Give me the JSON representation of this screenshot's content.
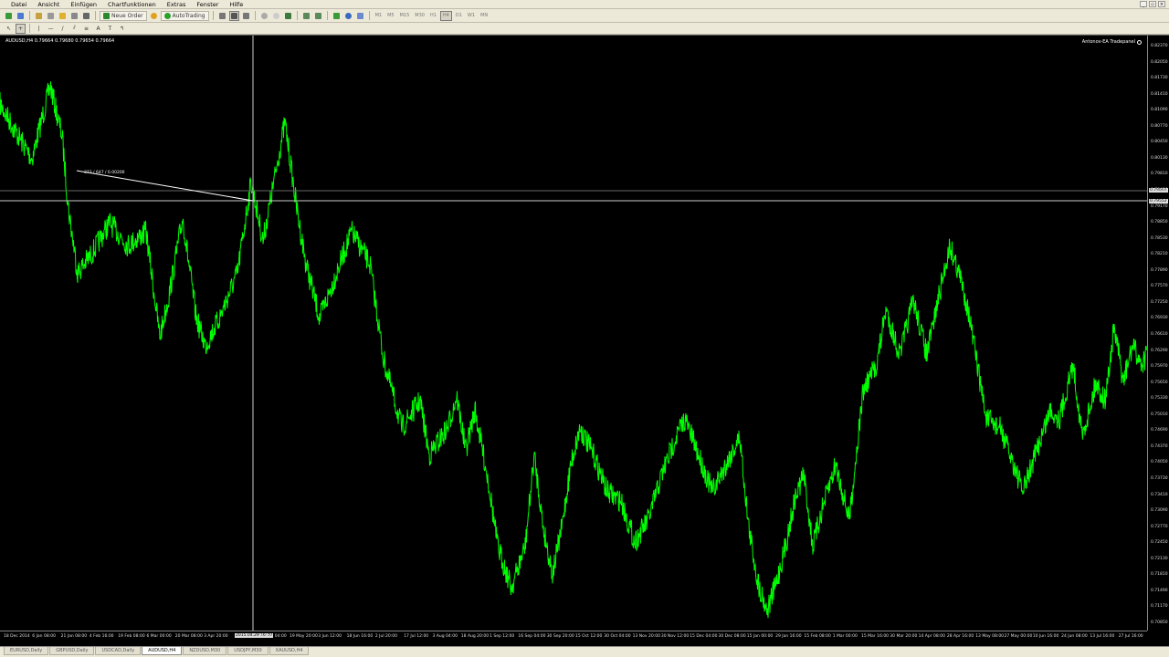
{
  "menu": {
    "items": [
      "Datei",
      "Ansicht",
      "Einfügen",
      "Chartfunktionen",
      "Extras",
      "Fenster",
      "Hilfe"
    ]
  },
  "toolbar": {
    "new_order_label": "Neue Order",
    "autotrading_label": "AutoTrading",
    "timeframes": [
      "M1",
      "M5",
      "M15",
      "M30",
      "H1",
      "H4",
      "D1",
      "W1",
      "MN"
    ]
  },
  "chart": {
    "symbol_header": "AUDUSD,H4  0.79664 0.79680 0.79654 0.79664",
    "ea_label": "Antonov-EA Tradepanel",
    "measure_label": "373 / 647 / 0.00200",
    "crosshair_time": "2015.04.29 16:00",
    "current_price_tag": "0.79664",
    "crosshair_price_tag": "0.79552",
    "line_color": "#00ff00",
    "price_labels": [
      "0.82370",
      "0.82050",
      "0.81730",
      "0.81410",
      "0.81090",
      "0.80770",
      "0.80450",
      "0.80130",
      "0.79810",
      "0.79490",
      "0.79170",
      "0.78850",
      "0.78530",
      "0.78210",
      "0.77890",
      "0.77570",
      "0.77250",
      "0.76930",
      "0.76610",
      "0.76290",
      "0.75970",
      "0.75650",
      "0.75330",
      "0.75010",
      "0.74690",
      "0.74370",
      "0.74050",
      "0.73730",
      "0.73410",
      "0.73090",
      "0.72770",
      "0.72450",
      "0.72130",
      "0.71810",
      "0.71490",
      "0.71170",
      "0.70850"
    ],
    "time_labels": [
      "18 Dec 2014",
      "6 Jan 08:00",
      "21 Jan 08:00",
      "4 Feb 16:00",
      "19 Feb 08:00",
      "6 Mar 00:00",
      "20 Mar 08:00",
      "3 Apr 20:00",
      "",
      "4 May 04:00",
      "19 May 20:00",
      "3 Jun 12:00",
      "18 Jun 16:00",
      "2 Jul 20:00",
      "17 Jul 12:00",
      "3 Aug 04:00",
      "18 Aug 20:00",
      "1 Sep 12:00",
      "16 Sep 04:00",
      "30 Sep 20:00",
      "15 Oct 12:00",
      "30 Oct 04:00",
      "13 Nov 20:00",
      "30 Nov 12:00",
      "15 Dec 04:00",
      "30 Dec 08:00",
      "15 Jan 00:00",
      "29 Jan 16:00",
      "15 Feb 08:00",
      "1 Mar 00:00",
      "15 Mar 16:00",
      "30 Mar 20:00",
      "14 Apr 08:00",
      "28 Apr 16:00",
      "13 May 08:00",
      "27 May 00:00",
      "10 Jun 16:00",
      "24 Jun 08:00",
      "13 Jul 16:00",
      "27 Jul 16:00"
    ]
  },
  "tabs": {
    "items": [
      "EURUSD,Daily",
      "GBPUSD,Daily",
      "USDCAD,Daily",
      "AUDUSD,H4",
      "NZDUSD,M30",
      "USDJPY,M30",
      "XAUUSD,H4"
    ],
    "active_index": 3
  }
}
